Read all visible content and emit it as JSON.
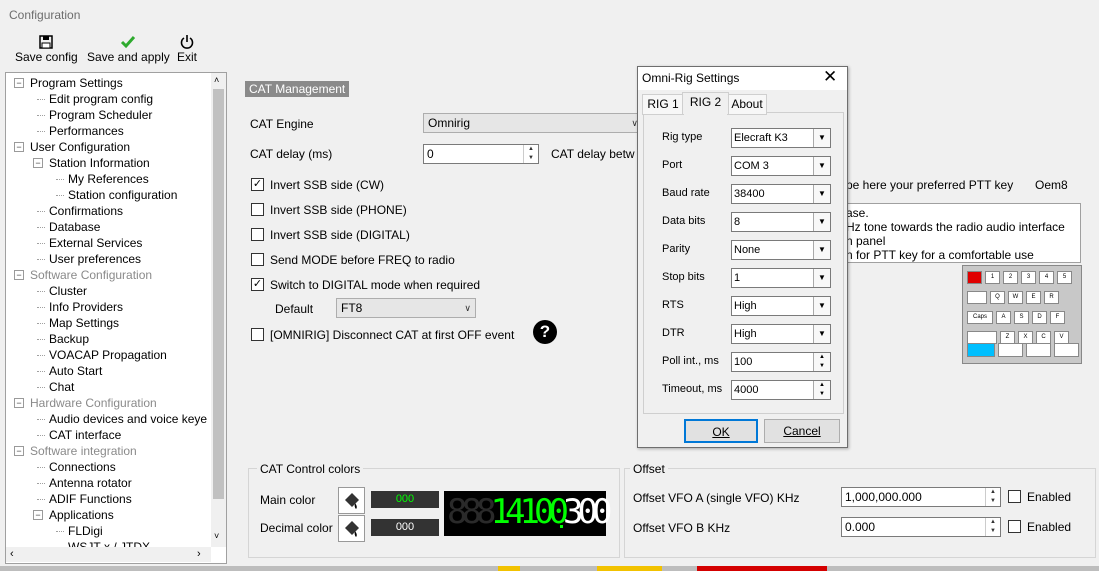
{
  "window": {
    "title": "Configuration"
  },
  "toolbar": {
    "save_config": "Save config",
    "save_apply": "Save and apply",
    "exit": "Exit"
  },
  "tree": {
    "items": [
      {
        "label": "Program Settings",
        "level": 0,
        "gray": false,
        "expander": "-"
      },
      {
        "label": "Edit program config",
        "level": 1
      },
      {
        "label": "Program Scheduler",
        "level": 1
      },
      {
        "label": "Performances",
        "level": 1
      },
      {
        "label": "User Configuration",
        "level": 0,
        "expander": "-"
      },
      {
        "label": "Station Information",
        "level": 1,
        "expander": "-"
      },
      {
        "label": "My References",
        "level": 2
      },
      {
        "label": "Station configuration",
        "level": 2
      },
      {
        "label": "Confirmations",
        "level": 1
      },
      {
        "label": "Database",
        "level": 1
      },
      {
        "label": "External Services",
        "level": 1
      },
      {
        "label": "User preferences",
        "level": 1
      },
      {
        "label": "Software Configuration",
        "level": 0,
        "gray": true,
        "expander": "-"
      },
      {
        "label": "Cluster",
        "level": 1
      },
      {
        "label": "Info Providers",
        "level": 1
      },
      {
        "label": "Map Settings",
        "level": 1
      },
      {
        "label": "Backup",
        "level": 1
      },
      {
        "label": "VOACAP Propagation",
        "level": 1
      },
      {
        "label": "Auto Start",
        "level": 1
      },
      {
        "label": "Chat",
        "level": 1
      },
      {
        "label": "Hardware Configuration",
        "level": 0,
        "gray": true,
        "expander": "-"
      },
      {
        "label": "Audio devices and voice keye",
        "level": 1
      },
      {
        "label": "CAT interface",
        "level": 1
      },
      {
        "label": "Software integration",
        "level": 0,
        "gray": true,
        "expander": "-"
      },
      {
        "label": "Connections",
        "level": 1
      },
      {
        "label": "Antenna rotator",
        "level": 1
      },
      {
        "label": "ADIF Functions",
        "level": 1
      },
      {
        "label": "Applications",
        "level": 1,
        "expander": "-"
      },
      {
        "label": "FLDigi",
        "level": 2
      },
      {
        "label": "WSJT-x / JTDX",
        "level": 2
      }
    ]
  },
  "cat": {
    "header": "CAT Management",
    "engine_label": "CAT Engine",
    "engine_value": "Omnirig",
    "delay_label": "CAT delay (ms)",
    "delay_value": "0",
    "delay_between": "CAT delay betw",
    "invert_cw": "Invert SSB side (CW)",
    "invert_phone": "Invert SSB side (PHONE)",
    "invert_digital": "Invert SSB side (DIGITAL)",
    "send_mode": "Send MODE before FREQ to radio",
    "switch_digital": "Switch to DIGITAL mode when required",
    "default_label": "Default",
    "default_value": "FT8",
    "omnirig_disconnect": "[OMNIRIG] Disconnect CAT at first OFF event"
  },
  "ptt": {
    "hint": "pe here your preferred PTT key",
    "key": "Oem8",
    "line1": "ase.",
    "line2": "Hz tone towards the radio audio interface",
    "line3": "n panel",
    "line4": "n for PTT key for a comfortable use"
  },
  "colors": {
    "title": "CAT Control colors",
    "main_label": "Main color",
    "main_value": "000",
    "decimal_label": "Decimal color",
    "decimal_value": "000",
    "lcd_digits": "14100.300",
    "main_color": "#00ff00",
    "decimal_color": "#ffffff"
  },
  "offset": {
    "title": "Offset",
    "vfo_a_label": "Offset VFO A (single VFO) KHz",
    "vfo_a_value": "1,000,000.000",
    "vfo_b_label": "Offset VFO B KHz",
    "vfo_b_value": "0.000",
    "enabled": "Enabled"
  },
  "omnirig": {
    "title": "Omni-Rig Settings",
    "tabs": [
      "RIG 1",
      "RIG 2",
      "About"
    ],
    "active_tab": "RIG 2",
    "rows": [
      {
        "label": "Rig type",
        "value": "Elecraft K3",
        "kind": "combo"
      },
      {
        "label": "Port",
        "value": "COM 3",
        "kind": "combo"
      },
      {
        "label": "Baud rate",
        "value": "38400",
        "kind": "combo"
      },
      {
        "label": "Data bits",
        "value": "8",
        "kind": "combo"
      },
      {
        "label": "Parity",
        "value": "None",
        "kind": "combo"
      },
      {
        "label": "Stop bits",
        "value": "1",
        "kind": "combo"
      },
      {
        "label": "RTS",
        "value": "High",
        "kind": "combo"
      },
      {
        "label": "DTR",
        "value": "High",
        "kind": "combo"
      },
      {
        "label": "Poll int., ms",
        "value": "100",
        "kind": "spin"
      },
      {
        "label": "Timeout, ms",
        "value": "4000",
        "kind": "spin"
      }
    ],
    "ok": "OK",
    "cancel": "Cancel"
  },
  "keyboard": {
    "row1": [
      "",
      "1",
      "2",
      "3",
      "4",
      "5"
    ],
    "row2": [
      "",
      "Q",
      "W",
      "E",
      "R"
    ],
    "row3": [
      "Caps",
      "A",
      "S",
      "D",
      "F"
    ],
    "row4": [
      "",
      "Z",
      "X",
      "C",
      "V"
    ]
  }
}
